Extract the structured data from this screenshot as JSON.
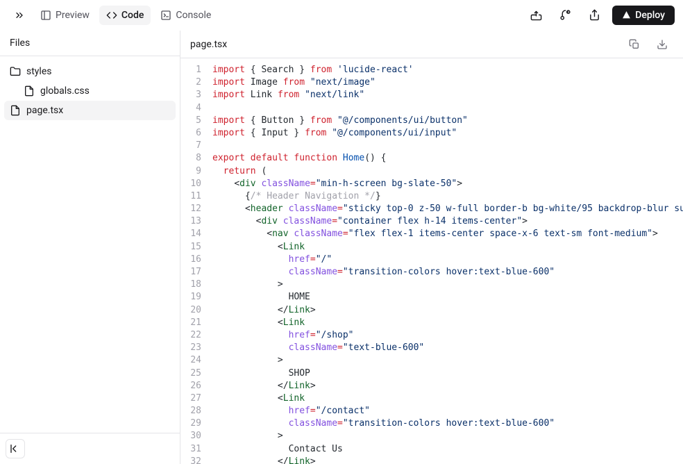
{
  "topbar": {
    "tabs": [
      {
        "label": "Preview",
        "icon": "panel-icon"
      },
      {
        "label": "Code",
        "icon": "code-icon"
      },
      {
        "label": "Console",
        "icon": "terminal-icon"
      }
    ],
    "actions": {
      "deploy_label": "Deploy"
    }
  },
  "sidebar": {
    "header": "Files",
    "items": [
      {
        "name": "styles",
        "type": "folder",
        "indent": 0
      },
      {
        "name": "globals.css",
        "type": "file",
        "indent": 1
      },
      {
        "name": "page.tsx",
        "type": "file",
        "indent": 0,
        "selected": true
      }
    ]
  },
  "editor": {
    "filename": "page.tsx",
    "lines": [
      [
        [
          "kw",
          "import"
        ],
        [
          "id",
          " "
        ],
        [
          "punc",
          "{"
        ],
        [
          "id",
          " Search "
        ],
        [
          "punc",
          "}"
        ],
        [
          "id",
          " "
        ],
        [
          "kw",
          "from"
        ],
        [
          "id",
          " "
        ],
        [
          "str",
          "'lucide-react'"
        ]
      ],
      [
        [
          "kw",
          "import"
        ],
        [
          "id",
          " Image "
        ],
        [
          "kw",
          "from"
        ],
        [
          "id",
          " "
        ],
        [
          "str",
          "\"next/image\""
        ]
      ],
      [
        [
          "kw",
          "import"
        ],
        [
          "id",
          " Link "
        ],
        [
          "kw",
          "from"
        ],
        [
          "id",
          " "
        ],
        [
          "str",
          "\"next/link\""
        ]
      ],
      [],
      [
        [
          "kw",
          "import"
        ],
        [
          "id",
          " "
        ],
        [
          "punc",
          "{"
        ],
        [
          "id",
          " Button "
        ],
        [
          "punc",
          "}"
        ],
        [
          "id",
          " "
        ],
        [
          "kw",
          "from"
        ],
        [
          "id",
          " "
        ],
        [
          "str",
          "\"@/components/ui/button\""
        ]
      ],
      [
        [
          "kw",
          "import"
        ],
        [
          "id",
          " "
        ],
        [
          "punc",
          "{"
        ],
        [
          "id",
          " Input "
        ],
        [
          "punc",
          "}"
        ],
        [
          "id",
          " "
        ],
        [
          "kw",
          "from"
        ],
        [
          "id",
          " "
        ],
        [
          "str",
          "\"@/components/ui/input\""
        ]
      ],
      [],
      [
        [
          "kw",
          "export"
        ],
        [
          "id",
          " "
        ],
        [
          "kw",
          "default"
        ],
        [
          "id",
          " "
        ],
        [
          "kw",
          "function"
        ],
        [
          "id",
          " "
        ],
        [
          "name",
          "Home"
        ],
        [
          "punc",
          "()"
        ],
        [
          "id",
          " "
        ],
        [
          "punc",
          "{"
        ]
      ],
      [
        [
          "id",
          "  "
        ],
        [
          "kw",
          "return"
        ],
        [
          "id",
          " "
        ],
        [
          "punc",
          "("
        ]
      ],
      [
        [
          "id",
          "    "
        ],
        [
          "punc",
          "<"
        ],
        [
          "tag",
          "div"
        ],
        [
          "id",
          " "
        ],
        [
          "attr",
          "className"
        ],
        [
          "op",
          "="
        ],
        [
          "str",
          "\"min-h-screen bg-slate-50\""
        ],
        [
          "punc",
          ">"
        ]
      ],
      [
        [
          "id",
          "      "
        ],
        [
          "punc",
          "{"
        ],
        [
          "cmt",
          "/* Header Navigation */"
        ],
        [
          "punc",
          "}"
        ]
      ],
      [
        [
          "id",
          "      "
        ],
        [
          "punc",
          "<"
        ],
        [
          "tag",
          "header"
        ],
        [
          "id",
          " "
        ],
        [
          "attr",
          "className"
        ],
        [
          "op",
          "="
        ],
        [
          "str",
          "\"sticky top-0 z-50 w-full border-b bg-white/95 backdrop-blur su"
        ]
      ],
      [
        [
          "id",
          "        "
        ],
        [
          "punc",
          "<"
        ],
        [
          "tag",
          "div"
        ],
        [
          "id",
          " "
        ],
        [
          "attr",
          "className"
        ],
        [
          "op",
          "="
        ],
        [
          "str",
          "\"container flex h-14 items-center\""
        ],
        [
          "punc",
          ">"
        ]
      ],
      [
        [
          "id",
          "          "
        ],
        [
          "punc",
          "<"
        ],
        [
          "tag",
          "nav"
        ],
        [
          "id",
          " "
        ],
        [
          "attr",
          "className"
        ],
        [
          "op",
          "="
        ],
        [
          "str",
          "\"flex flex-1 items-center space-x-6 text-sm font-medium\""
        ],
        [
          "punc",
          ">"
        ]
      ],
      [
        [
          "id",
          "            "
        ],
        [
          "punc",
          "<"
        ],
        [
          "tag",
          "Link"
        ]
      ],
      [
        [
          "id",
          "              "
        ],
        [
          "attr",
          "href"
        ],
        [
          "op",
          "="
        ],
        [
          "str",
          "\"/\""
        ]
      ],
      [
        [
          "id",
          "              "
        ],
        [
          "attr",
          "className"
        ],
        [
          "op",
          "="
        ],
        [
          "str",
          "\"transition-colors hover:text-blue-600\""
        ]
      ],
      [
        [
          "id",
          "            "
        ],
        [
          "punc",
          ">"
        ]
      ],
      [
        [
          "id",
          "              HOME"
        ]
      ],
      [
        [
          "id",
          "            "
        ],
        [
          "punc",
          "</"
        ],
        [
          "tag",
          "Link"
        ],
        [
          "punc",
          ">"
        ]
      ],
      [
        [
          "id",
          "            "
        ],
        [
          "punc",
          "<"
        ],
        [
          "tag",
          "Link"
        ]
      ],
      [
        [
          "id",
          "              "
        ],
        [
          "attr",
          "href"
        ],
        [
          "op",
          "="
        ],
        [
          "str",
          "\"/shop\""
        ]
      ],
      [
        [
          "id",
          "              "
        ],
        [
          "attr",
          "className"
        ],
        [
          "op",
          "="
        ],
        [
          "str",
          "\"text-blue-600\""
        ]
      ],
      [
        [
          "id",
          "            "
        ],
        [
          "punc",
          ">"
        ]
      ],
      [
        [
          "id",
          "              SHOP"
        ]
      ],
      [
        [
          "id",
          "            "
        ],
        [
          "punc",
          "</"
        ],
        [
          "tag",
          "Link"
        ],
        [
          "punc",
          ">"
        ]
      ],
      [
        [
          "id",
          "            "
        ],
        [
          "punc",
          "<"
        ],
        [
          "tag",
          "Link"
        ]
      ],
      [
        [
          "id",
          "              "
        ],
        [
          "attr",
          "href"
        ],
        [
          "op",
          "="
        ],
        [
          "str",
          "\"/contact\""
        ]
      ],
      [
        [
          "id",
          "              "
        ],
        [
          "attr",
          "className"
        ],
        [
          "op",
          "="
        ],
        [
          "str",
          "\"transition-colors hover:text-blue-600\""
        ]
      ],
      [
        [
          "id",
          "            "
        ],
        [
          "punc",
          ">"
        ]
      ],
      [
        [
          "id",
          "              Contact Us"
        ]
      ],
      [
        [
          "id",
          "            "
        ],
        [
          "punc",
          "</"
        ],
        [
          "tag",
          "Link"
        ],
        [
          "punc",
          ">"
        ]
      ]
    ]
  }
}
